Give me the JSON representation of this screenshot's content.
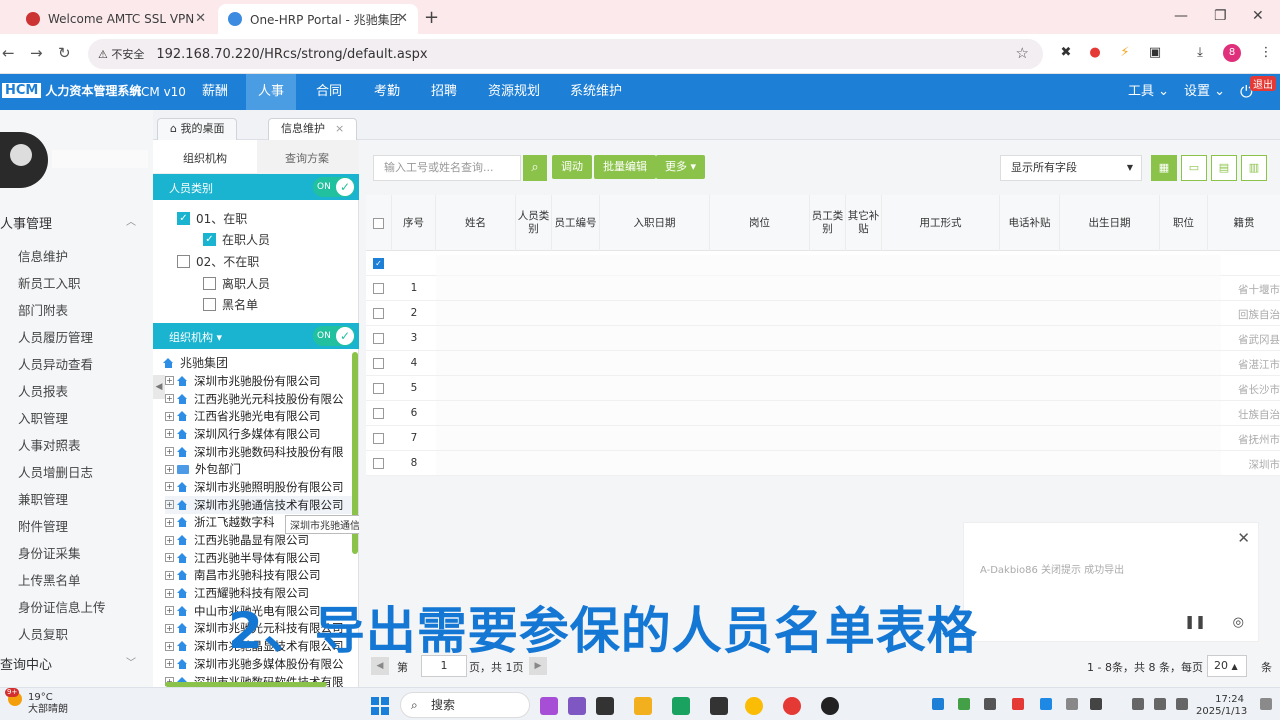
{
  "browser": {
    "tabs": [
      {
        "title": "Welcome AMTC SSL VPN"
      },
      {
        "title": "One-HRP Portal - 兆驰集团测"
      }
    ],
    "new_tab": "+",
    "security_warning": "不安全",
    "url": "192.168.70.220/HRcs/strong/default.aspx",
    "profile_initial": "8"
  },
  "app": {
    "logo_hcm": "HCM",
    "logo_name": "人力资本管理系统",
    "version": "HCM v10",
    "menu": [
      "薪酬",
      "人事",
      "合同",
      "考勤",
      "招聘",
      "资源规划",
      "系统维护"
    ],
    "active_menu": "人事",
    "tools": "工具",
    "settings": "设置",
    "exit": "退出",
    "colors": {
      "nav": "#1e7fd6",
      "accent_green": "#8bc34a",
      "cyan": "#1ab4d1",
      "caption": "#1477d4"
    }
  },
  "sidebar": {
    "section1": "人事管理",
    "items": [
      "信息维护",
      "新员工入职",
      "部门附表",
      "人员履历管理",
      "人员异动查看",
      "人员报表",
      "入职管理",
      "人事对照表",
      "人员增删日志",
      "兼职管理",
      "附件管理",
      "身份证采集",
      "上传黑名单",
      "身份证信息上传",
      "人员复职"
    ],
    "section2": "查询中心"
  },
  "inner_tabs": {
    "home": "我的桌面",
    "current": "信息维护",
    "close": "×"
  },
  "org_panel": {
    "subtab_org": "组织机构",
    "subtab_query": "查询方案",
    "category_bar": "人员类别",
    "toggle_on": "ON",
    "categories": [
      {
        "label": "01、在职",
        "checked": true
      },
      {
        "label": "在职人员",
        "checked": true
      },
      {
        "label": "02、不在职",
        "checked": false
      },
      {
        "label": "离职人员",
        "checked": false
      },
      {
        "label": "黑名单",
        "checked": false
      }
    ],
    "org_bar": "组织机构",
    "tree_root": "兆驰集团",
    "tree_nodes": [
      "深圳市兆驰股份有限公司",
      "江西兆驰光元科技股份有限公",
      "江西省兆驰光电有限公司",
      "深圳风行多媒体有限公司",
      "深圳市兆驰数码科技股份有限",
      "外包部门",
      "深圳市兆驰照明股份有限公司",
      "深圳市兆驰通信技术有限公司",
      "浙江飞越数字科",
      "江西兆驰晶显有限公司",
      "江西兆驰半导体有限公司",
      "南昌市兆驰科技有限公司",
      "江西耀驰科技有限公司",
      "中山市兆驰光电有限公司",
      "深圳市兆驰光元科技有限公司",
      "深圳市兆驰晶显技术有限公司",
      "深圳市兆驰多媒体股份有限公",
      "深圳市兆驰数码软件技术有限"
    ],
    "tooltip": "深圳市兆驰通信技术有限公司"
  },
  "toolbar": {
    "search_placeholder": "输入工号或姓名查询...",
    "btn_transfer": "调动",
    "btn_batch": "批量编辑",
    "btn_more": "更多",
    "field_select": "显示所有字段"
  },
  "grid": {
    "headers": [
      "序号",
      "姓名",
      "人员类别",
      "员工编号",
      "入职日期",
      "岗位",
      "员工类别",
      "其它补贴",
      "用工形式",
      "电话补贴",
      "出生日期",
      "职位",
      "籍贯"
    ],
    "rows": [
      {
        "num": "1",
        "tail": "省十堰市"
      },
      {
        "num": "2",
        "tail": "回族自治"
      },
      {
        "num": "3",
        "tail": "省武冈县"
      },
      {
        "num": "4",
        "tail": "省湛江市"
      },
      {
        "num": "5",
        "tail": "省长沙市"
      },
      {
        "num": "6",
        "tail": "壮族自治"
      },
      {
        "num": "7",
        "tail": "省抚州市"
      },
      {
        "num": "8",
        "tail": "深圳市"
      }
    ]
  },
  "popup": {
    "text": "A-Dakbio86 关闭提示 成功导出"
  },
  "caption": "2、导出需要参保的人员名单表格",
  "pager": {
    "page_label": "第",
    "page_value": "1",
    "page_suffix": "页，共 1页",
    "summary": "1 - 8条，共 8 条，每页",
    "page_size": "20",
    "size_unit": "条"
  },
  "taskbar": {
    "weather_badge": "9+",
    "temperature": "19°C",
    "weather_desc": "大部晴朗",
    "search": "搜索",
    "time": "17:24",
    "date": "2025/1/13"
  }
}
